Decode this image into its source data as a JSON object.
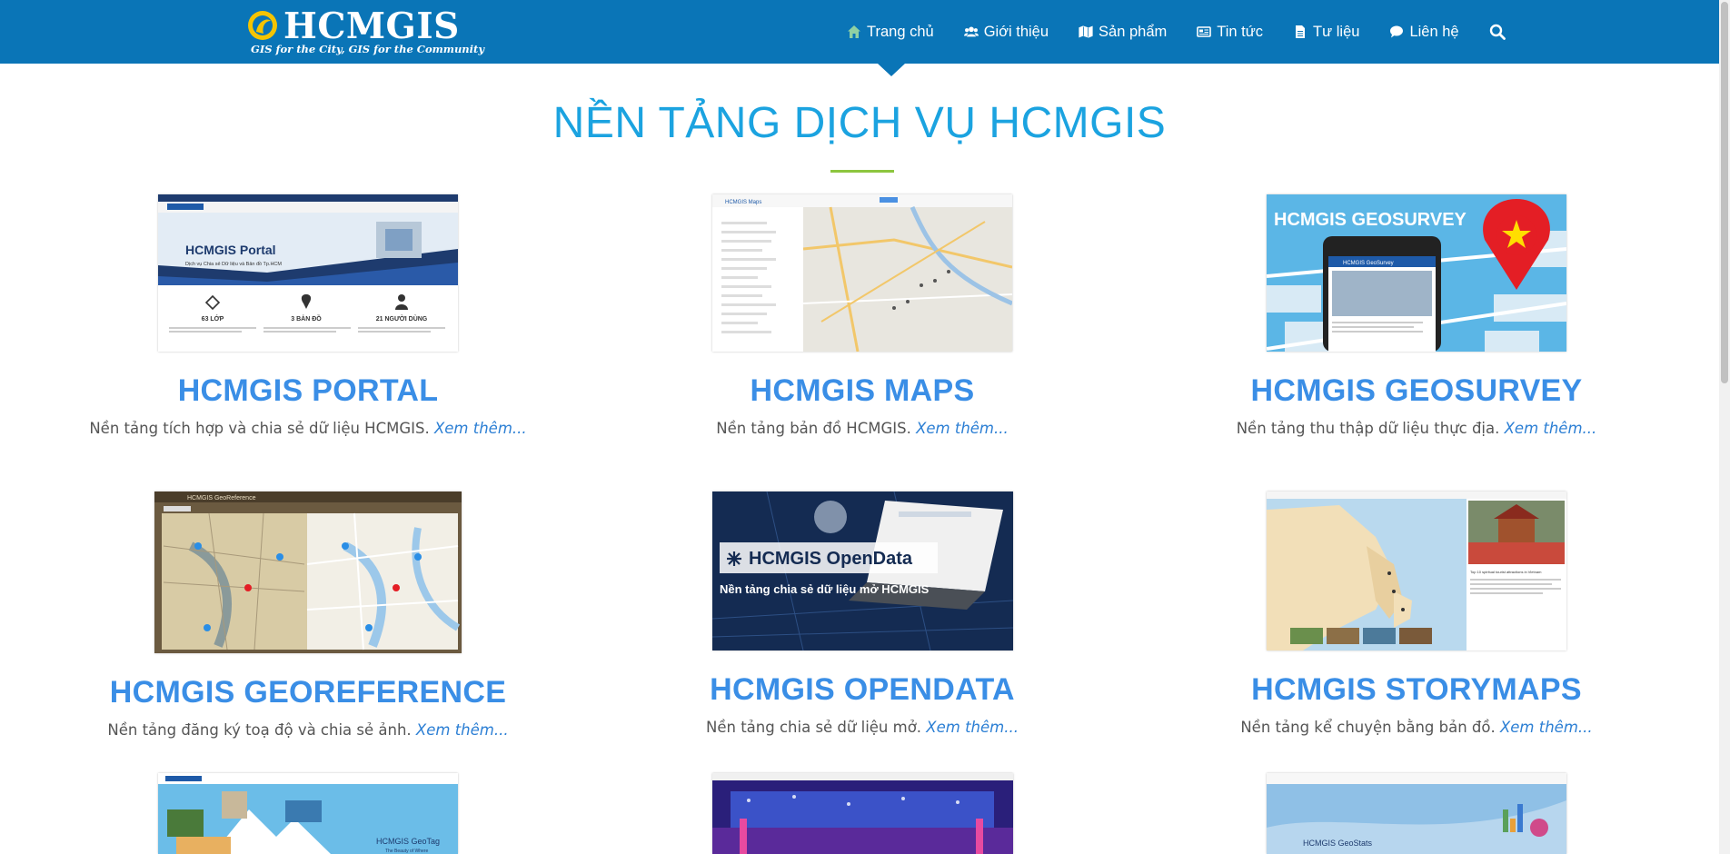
{
  "brand": {
    "name": "HCMGIS",
    "tagline": "GIS for the City, GIS for the Community"
  },
  "nav": {
    "items": [
      {
        "label": "Trang chủ",
        "icon": "home-icon",
        "active": true
      },
      {
        "label": "Giới thiệu",
        "icon": "users-icon"
      },
      {
        "label": "Sản phẩm",
        "icon": "map-icon"
      },
      {
        "label": "Tin tức",
        "icon": "newspaper-icon"
      },
      {
        "label": "Tư liệu",
        "icon": "file-icon"
      },
      {
        "label": "Liên hệ",
        "icon": "chat-icon"
      }
    ],
    "search_icon": "search-icon"
  },
  "section": {
    "title": "NỀN TẢNG DỊCH VỤ HCMGIS"
  },
  "cards": [
    {
      "title": "HCMGIS PORTAL",
      "desc": "Nền tảng tích hợp và chia sẻ dữ liệu HCMGIS.",
      "more": "Xem thêm...",
      "thumb": {
        "heading": "HCMGIS Portal",
        "subheading": "Dịch vụ Chia sẻ Dữ liệu và Bản đồ Tp.HCM",
        "stats": [
          "63 LỚP",
          "3 BẢN ĐỒ",
          "21 NGƯỜI DÙNG"
        ]
      }
    },
    {
      "title": "HCMGIS MAPS",
      "desc": "Nền tảng bản đồ HCMGIS.",
      "more": "Xem thêm...",
      "thumb": {
        "heading": "HCMGIS Maps"
      }
    },
    {
      "title": "HCMGIS GEOSURVEY",
      "desc": "Nền tảng thu thập dữ liệu thực địa.",
      "more": "Xem thêm...",
      "thumb": {
        "heading": "HCMGIS GEOSURVEY",
        "app_title": "HCMGIS GeoSurvey"
      }
    },
    {
      "title": "HCMGIS GEOREFERENCE",
      "desc": "Nền tảng đăng ký toạ độ và chia sẻ ảnh.",
      "more": "Xem thêm...",
      "thumb": {
        "heading": "HCMGIS GeoReference"
      }
    },
    {
      "title": "HCMGIS OPENDATA",
      "desc": "Nền tảng chia sẻ dữ liệu mở.",
      "more": "Xem thêm...",
      "thumb": {
        "heading": "HCMGIS OpenData",
        "subheading": "Nền tảng chia sẻ dữ liệu mở HCMGIS"
      }
    },
    {
      "title": "HCMGIS STORYMAPS",
      "desc": "Nền tảng kể chuyện bằng bản đồ.",
      "more": "Xem thêm...",
      "thumb": {
        "heading": "Top 10 spiritual tourist attractions in Vietnam"
      }
    },
    {
      "title": "",
      "desc": "",
      "more": "",
      "thumb": {
        "heading": "HCMGIS GeoTag",
        "subheading": "The Beauty of Where"
      }
    },
    {
      "title": "",
      "desc": "",
      "more": "",
      "thumb": {
        "heading": ""
      }
    },
    {
      "title": "",
      "desc": "",
      "more": "",
      "thumb": {
        "heading": "HCMGIS GeoStats"
      }
    }
  ],
  "colors": {
    "header": "#0a75b7",
    "section_title": "#1ba3e0",
    "card_title": "#3a8ee6",
    "divider": "#8dc63f",
    "link": "#2c7fd4"
  }
}
